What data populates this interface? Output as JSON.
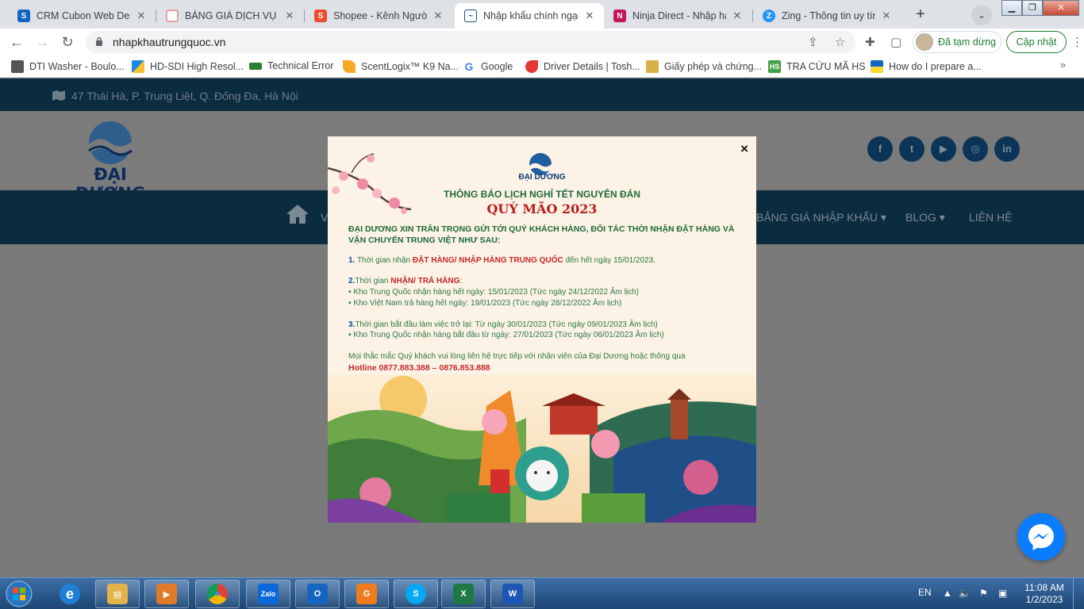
{
  "browser": {
    "tabs": [
      {
        "title": "CRM Cubon Web Design",
        "active": false
      },
      {
        "title": "BẢNG GIÁ DỊCH VỤ ĐẶT",
        "active": false
      },
      {
        "title": "Shopee - Kênh Người bán",
        "active": false
      },
      {
        "title": "Nhập khẩu chính ngạch",
        "active": true
      },
      {
        "title": "Ninja Direct - Nhập hàng",
        "active": false
      },
      {
        "title": "Zing - Thông tin uy tín,",
        "active": false
      }
    ],
    "close_glyph": "✕",
    "new_tab_glyph": "+",
    "url": "nhapkhautrungquoc.vn",
    "profile_label": "Đã tạm dừng",
    "update_label": "Cập nhật",
    "bookmarks": [
      {
        "label": "DTI Washer - Boulo..."
      },
      {
        "label": "HD-SDI High Resol..."
      },
      {
        "label": "Technical Error"
      },
      {
        "label": "ScentLogix™ K9 Na..."
      },
      {
        "label": "Google"
      },
      {
        "label": "Driver Details | Tosh..."
      },
      {
        "label": "Giấy phép và chứng..."
      },
      {
        "label": "TRA CỨU MÃ HS"
      },
      {
        "label": "How do I prepare a..."
      }
    ],
    "bookmarks_more": "»"
  },
  "site": {
    "address": "47 Thái Hà, P. Trung Liệt, Q. Đống Đa, Hà Nội",
    "logo_text": "ĐẠI DƯƠNG",
    "social": [
      {
        "icon": "facebook-icon",
        "glyph": "f"
      },
      {
        "icon": "twitter-icon",
        "glyph": "t"
      },
      {
        "icon": "youtube-icon",
        "glyph": "▶"
      },
      {
        "icon": "instagram-icon",
        "glyph": "◎"
      },
      {
        "icon": "linkedin-icon",
        "glyph": "in"
      }
    ],
    "nav": {
      "partial_label": "V",
      "price_label": "BẢNG GIÁ NHẬP KHẨU",
      "blog_label": "BLOG",
      "contact_label": "LIÊN HỆ",
      "caret": "▾"
    }
  },
  "popup": {
    "close": "×",
    "brand": "ĐẠI DƯƠNG",
    "heading": "THÔNG BÁO LỊCH NGHỈ TẾT NGUYÊN ĐÁN",
    "year": "QUÝ MÃO 2023",
    "intro": "ĐẠI DƯƠNG XIN TRÂN TRỌNG GỬI TỚI QUÝ KHÁCH HÀNG, ĐỐI TÁC THỜI NHẬN ĐẶT HÀNG VÀ VẬN CHUYỂN TRUNG VIỆT NHƯ SAU:",
    "item1": {
      "num": "1.",
      "pre": " Thời gian nhận ",
      "hl": "ĐẶT HÀNG/ NHẬP HÀNG TRUNG QUỐC",
      "post": " đến hết ngày 15/01/2023."
    },
    "item2": {
      "num": "2.",
      "pre": "Thời gian ",
      "hl": "NHẬN/ TRẢ HÀNG",
      "post": ":"
    },
    "item2_lines": [
      "▪ Kho Trung Quốc nhận hàng hết ngày: 15/01/2023 (Tức ngày 24/12/2022 Âm lịch)",
      "▪ Kho Việt Nam trả hàng hết ngày: 19/01/2023 (Tức ngày 28/12/2022 Âm lịch)"
    ],
    "item3": {
      "num": "3.",
      "text": "Thời gian bắt đầu làm việc trở lại: Từ ngày 30/01/2023 (Tức ngày 09/01/2023 Âm lịch)"
    },
    "item3_lines": [
      "▪ Kho Trung Quốc nhận hàng bắt đầu từ ngày: 27/01/2023 (Tức ngày 06/01/2023 Âm lịch)"
    ],
    "contact": "Mọi thắc mắc Quý khách vui lòng liên hệ trực tiếp với nhân viên của Đại Dương hoặc thông qua",
    "hotline": "Hotline 0877.883.388 – 0876.853.888"
  },
  "taskbar": {
    "lang": "EN",
    "time": "11:08 AM",
    "date": "1/2/2023",
    "apps": [
      {
        "name": "ie",
        "glyph": "e",
        "color": "#1f7fd6"
      },
      {
        "name": "explorer",
        "glyph": "▤",
        "color": "#e3b34a"
      },
      {
        "name": "media",
        "glyph": "▶",
        "color": "#e07b2a"
      },
      {
        "name": "chrome",
        "glyph": "●",
        "color": "#3a9a45"
      },
      {
        "name": "zalo",
        "glyph": "Zalo",
        "color": "#0b68d8"
      },
      {
        "name": "outlook",
        "glyph": "O",
        "color": "#1565c0"
      },
      {
        "name": "foxit",
        "glyph": "G",
        "color": "#f07c1c"
      },
      {
        "name": "skype",
        "glyph": "S",
        "color": "#03a9f4"
      },
      {
        "name": "excel",
        "glyph": "X",
        "color": "#1e7a42"
      },
      {
        "name": "word",
        "glyph": "W",
        "color": "#1d56b5"
      }
    ]
  }
}
